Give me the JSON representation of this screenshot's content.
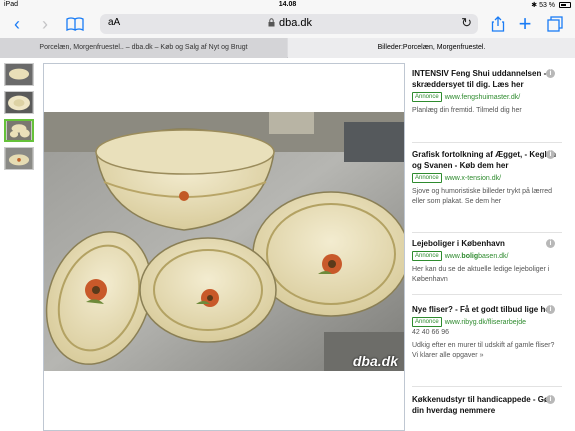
{
  "status": {
    "device": "iPad",
    "time": "14.08",
    "battery": "53 %"
  },
  "toolbar": {
    "aa": "aA",
    "host": "dba.dk"
  },
  "tabs": [
    {
      "label": "Porcelæn, Morgenfruestel.. – dba.dk – Køb og Salg af Nyt og Brugt"
    },
    {
      "label": "Billeder:Porcelæn, Morgenfruestel."
    }
  ],
  "image": {
    "watermark": "dba.dk"
  },
  "ads": [
    {
      "title": "INTENSIV Feng Shui uddannelsen - skræddersyet til dig. Læs her",
      "badge": "Annonce",
      "url": "www.fengshuimaster.dk/",
      "desc": "Planlæg din fremtid. Tilmeld dig her"
    },
    {
      "title": "Grafisk fortolkning af Ægget, - Keglen og Svanen - Køb dem her",
      "badge": "Annonce",
      "url": "www.x-tension.dk/",
      "desc": "Sjove og humoristiske billeder trykt på lærred eller som plakat. Se dem her"
    },
    {
      "title": "Lejeboliger i København",
      "badge": "Annonce",
      "url_pre": "www.",
      "url_bold": "bolig",
      "url_post": "basen.dk/",
      "desc": "Her kan du se de aktuelle ledige lejeboliger i København"
    },
    {
      "title": "Nye fliser? - Få et godt tilbud lige her",
      "badge": "Annonce",
      "url": "www.ribyg.dk/fliserarbejde",
      "phone": "42 40 66 96",
      "desc": "Udkig efter en murer til udskift af gamle fliser? Vi klarer alle opgaver »"
    },
    {
      "title": "Køkkenudstyr til handicappede - Gør din hverdag nemmere"
    }
  ],
  "colors": {
    "accent": "#1a7cf5",
    "ad_green": "#2e8b2e",
    "thumb_active": "#66c23a"
  }
}
